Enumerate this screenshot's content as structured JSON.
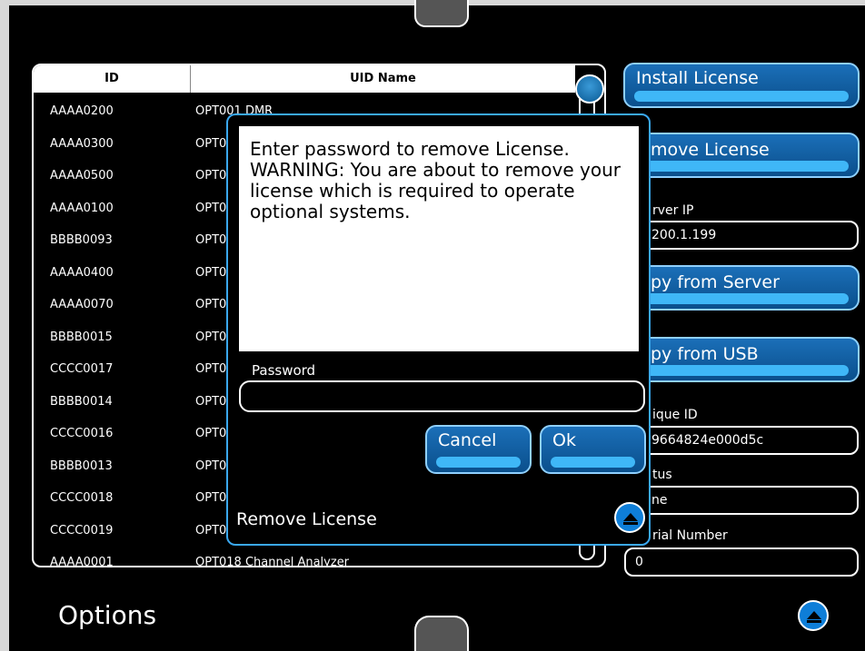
{
  "table": {
    "columns": {
      "id": "ID",
      "name": "UID Name"
    },
    "rows": [
      {
        "id": "AAAA0200",
        "name": "OPT001 DMR"
      },
      {
        "id": "AAAA0300",
        "name": "OPT0"
      },
      {
        "id": "AAAA0500",
        "name": "OPT0"
      },
      {
        "id": "AAAA0100",
        "name": "OPT0"
      },
      {
        "id": "BBBB0093",
        "name": "OPT0"
      },
      {
        "id": "AAAA0400",
        "name": "OPT0"
      },
      {
        "id": "AAAA0070",
        "name": "OPT0"
      },
      {
        "id": "BBBB0015",
        "name": "OPT0"
      },
      {
        "id": "CCCC0017",
        "name": "OPT0"
      },
      {
        "id": "BBBB0014",
        "name": "OPT0"
      },
      {
        "id": "CCCC0016",
        "name": "OPT0"
      },
      {
        "id": "BBBB0013",
        "name": "OPT0"
      },
      {
        "id": "CCCC0018",
        "name": "OPT0"
      },
      {
        "id": "CCCC0019",
        "name": "OPT0"
      },
      {
        "id": "AAAA0001",
        "name": "OPT018 Channel Analyzer"
      }
    ]
  },
  "right_panel": {
    "install_label": "Install License",
    "remove_label": "move License",
    "server_ip_label": "rver IP",
    "server_ip_value": "200.1.199",
    "copy_server_label": "py from Server",
    "copy_usb_label": "py from USB",
    "unique_id_label": "ique ID",
    "unique_id_value": "9664824e000d5c",
    "status_label": "tus",
    "status_value": "ne",
    "serial_label": "rial Number",
    "serial_value": "0"
  },
  "footer": {
    "title": "Options"
  },
  "dialog": {
    "message": "Enter password to remove License. WARNING: You are about to remove your license which is required to operate optional systems.",
    "password_label": "Password",
    "password_value": "",
    "cancel_label": "Cancel",
    "ok_label": "Ok",
    "title": "Remove License"
  },
  "colors": {
    "accent": "#0e7ed8",
    "button": "#1b6fb8",
    "button_highlight": "#3fb7f7",
    "dialog_border": "#3aa8f0"
  }
}
